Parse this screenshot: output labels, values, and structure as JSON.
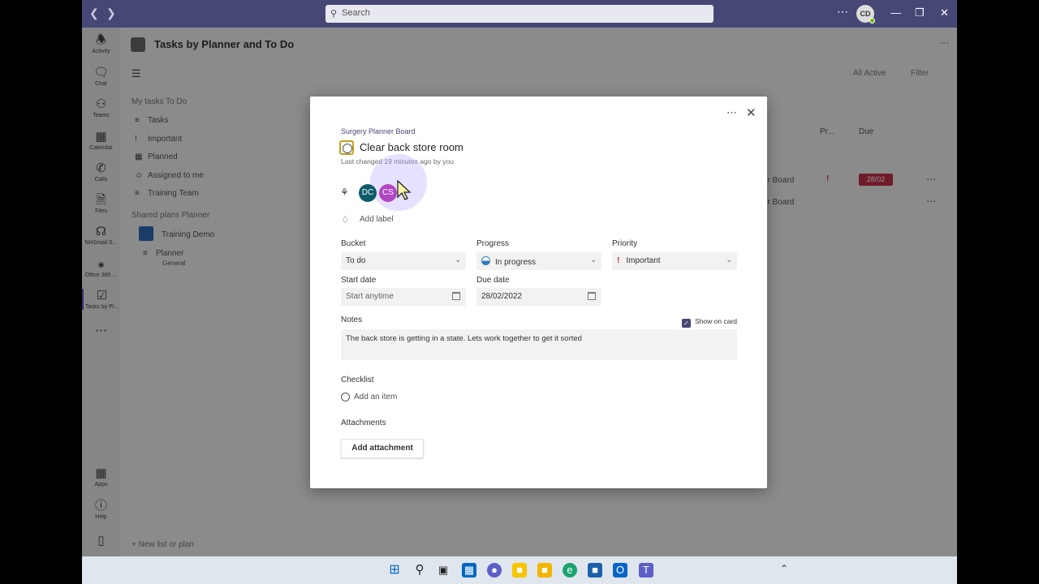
{
  "titlebar": {
    "search_placeholder": "Search",
    "avatar_initials": "CD",
    "more": "⋯"
  },
  "rail": {
    "items": [
      {
        "label": "Activity",
        "icon": "bell-icon"
      },
      {
        "label": "Chat",
        "icon": "chat-icon"
      },
      {
        "label": "Teams",
        "icon": "teams-icon"
      },
      {
        "label": "Calendar",
        "icon": "calendar-icon"
      },
      {
        "label": "Calls",
        "icon": "phone-icon"
      },
      {
        "label": "Files",
        "icon": "file-icon"
      },
      {
        "label": "NHSmail S...",
        "icon": "headset-icon"
      },
      {
        "label": "Office 365 ...",
        "icon": "dot-icon"
      },
      {
        "label": "Tasks by Pl...",
        "icon": "tasks-icon"
      },
      {
        "label": "Apps",
        "icon": "apps-icon"
      },
      {
        "label": "Help",
        "icon": "help-icon"
      }
    ],
    "more": "⋯"
  },
  "app": {
    "title": "Tasks by Planner and To Do",
    "filter_active": "All Active",
    "filter": "Filter",
    "my_tasks_label": "My tasks",
    "my_tasks_sub": "To Do",
    "nav": [
      "Tasks",
      "Important",
      "Planned",
      "Assigned to me",
      "Training Team"
    ],
    "shared_label": "Shared plans",
    "shared_sub": "Planner",
    "plan1": "Training Demo",
    "plan2": "Planner",
    "plan2_sub": "General",
    "col_priority": "Pr...",
    "col_due": "Due",
    "row1_board": "er Board",
    "row1_due": "28/02",
    "row2_board": "er Board",
    "new_list": "New list or plan"
  },
  "modal": {
    "plan_name": "Surgery Planner Board",
    "title": "Clear back store room",
    "last_changed": "Last changed 19 minutes ago by you",
    "assignees": [
      "DC",
      "CS"
    ],
    "add_label": "Add label",
    "bucket_label": "Bucket",
    "bucket_value": "To do",
    "progress_label": "Progress",
    "progress_value": "In progress",
    "priority_label": "Priority",
    "priority_value": "Important",
    "start_label": "Start date",
    "start_value": "Start anytime",
    "due_label": "Due date",
    "due_value": "28/02/2022",
    "notes_label": "Notes",
    "show_on_card": "Show on card",
    "notes_value": "The back store is getting in a state. Lets work together to get it sorted",
    "checklist_label": "Checklist",
    "add_item": "Add an item",
    "attachments_label": "Attachments",
    "add_attachment": "Add attachment"
  },
  "colors": {
    "brand": "#464775",
    "accent": "#5b5fc7",
    "due_overdue": "#c4314b"
  }
}
